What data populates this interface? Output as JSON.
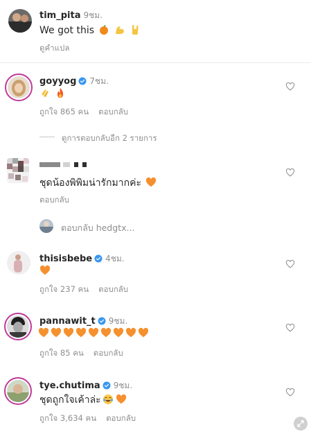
{
  "comments": [
    {
      "username": "tim_pita",
      "time": "9ชม.",
      "text": "We got this",
      "translate": "ดูคำแปล"
    },
    {
      "username": "goyyog",
      "time": "7ชม.",
      "likes": "ถูกใจ 865 คน",
      "reply": "ตอบกลับ",
      "view_replies": "ดูการตอบกลับอีก 2 รายการ"
    },
    {
      "username": "",
      "text": "ชุดน้องพิพิมน่ารักมากค่ะ",
      "reply": "ตอบกลับ",
      "reply_to": "ตอบกลับ hedgtx..."
    },
    {
      "username": "thisisbebe",
      "time": "4ชม.",
      "likes": "ถูกใจ 237 คน",
      "reply": "ตอบกลับ"
    },
    {
      "username": "pannawit_t",
      "time": "9ชม.",
      "likes": "ถูกใจ 85 คน",
      "reply": "ตอบกลับ"
    },
    {
      "username": "tye.chutima",
      "time": "9ชม.",
      "text": "ชุดถูกใจเค้าล่ะ",
      "likes": "ถูกใจ 3,634 คน",
      "reply": "ตอบกลับ"
    }
  ],
  "colors": {
    "orange_heart": "#f5902e",
    "verified": "#3897f0",
    "ring": "#c0399a"
  }
}
